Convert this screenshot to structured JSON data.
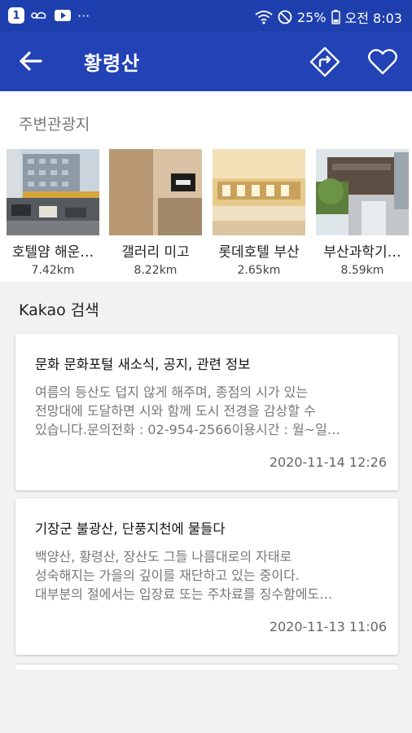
{
  "status_bar": {
    "badge": "1",
    "dots": "···",
    "battery": "25%",
    "clock": "오전 8:03",
    "icons": [
      "cloud-icon",
      "play-icon",
      "wifi-icon",
      "do-not-disturb-icon",
      "battery-icon"
    ]
  },
  "app_bar": {
    "title": "황령산",
    "icons": [
      "back-arrow-icon",
      "directions-icon",
      "heart-icon"
    ]
  },
  "nearby": {
    "title": "주변관광지",
    "places": [
      {
        "name": "호텔얌 해운…",
        "distance": "7.42km"
      },
      {
        "name": "갤러리 미고",
        "distance": "8.22km"
      },
      {
        "name": "롯데호텔 부산",
        "distance": "2.65km"
      },
      {
        "name": "부산과학기…",
        "distance": "8.59km"
      }
    ]
  },
  "kakao": {
    "title": "Kakao 검색",
    "results": [
      {
        "title": "문화 문화포털 새소식, 공지, 관련 정보",
        "lines": [
          "여름의 등산도 덥지 않게 해주며, 종점의 시가 있는",
          "전망대에 도달하면 시와 함께 도시 전경을 감상할 수",
          "있습니다.문의전화 : 02-954-2566이용시간 : 월~일…"
        ],
        "date": "2020-11-14 12:26"
      },
      {
        "title": "기장군 불광산, 단풍지천에 물들다",
        "lines": [
          "백양산, 황령산, 장산도 그들 나름대로의 자태로",
          "성숙해지는 가을의 깊이를 재단하고 있는 중이다.",
          "대부분의 절에서는 입장료 또는 주차료를 징수함에도…"
        ],
        "date": "2020-11-13 11:06"
      }
    ]
  },
  "colors": {
    "status_bar": "#1e3fae",
    "app_bar": "#2342b5",
    "background": "#f2f2f2"
  }
}
